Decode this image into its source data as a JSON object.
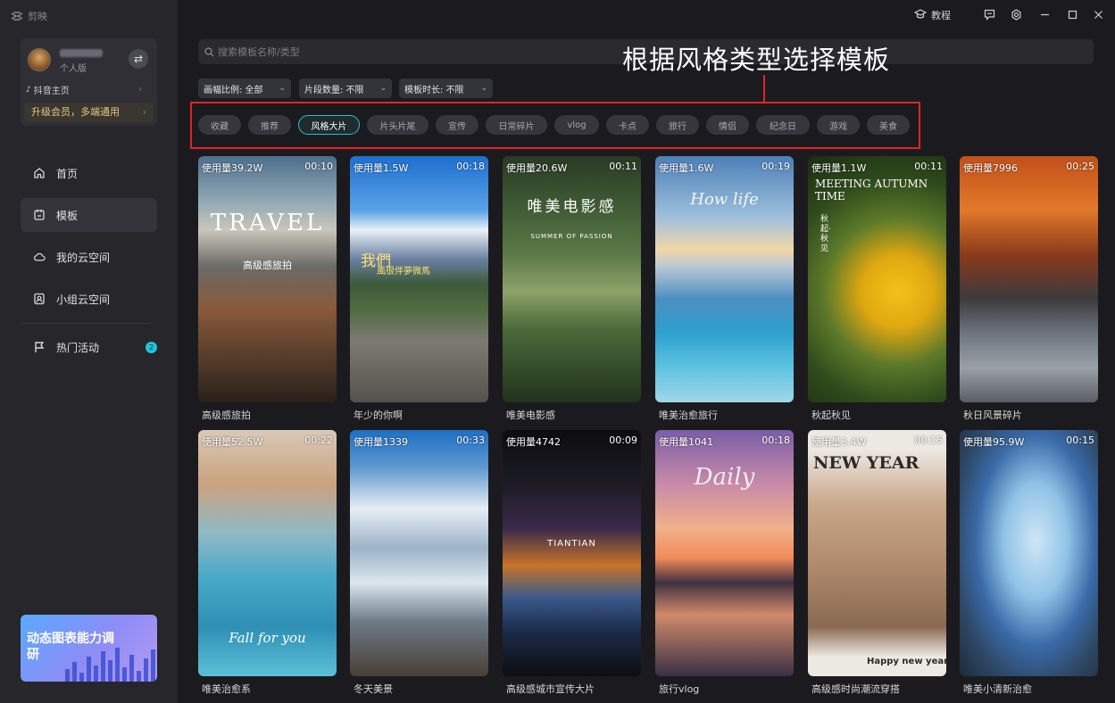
{
  "app": {
    "name": "剪映"
  },
  "profile": {
    "tier": "个人版",
    "douyin": "抖音主页",
    "upgrade": "升级会员，多端通用"
  },
  "nav": [
    {
      "label": "首页",
      "icon": "home-icon"
    },
    {
      "label": "模板",
      "icon": "template-icon"
    },
    {
      "label": "我的云空间",
      "icon": "cloud-icon"
    },
    {
      "label": "小组云空间",
      "icon": "group-cloud-icon"
    },
    {
      "label": "热门活动",
      "icon": "flag-icon",
      "badge": "2"
    }
  ],
  "banner": {
    "text": "动态图表能力调研"
  },
  "titlebar": {
    "tutorial": "教程"
  },
  "search": {
    "placeholder": "搜索模板名称/类型"
  },
  "annotation": {
    "text": "根据风格类型选择模板"
  },
  "filters": [
    {
      "label": "画幅比例: 全部"
    },
    {
      "label": "片段数量: 不限"
    },
    {
      "label": "模板时长: 不限"
    }
  ],
  "tags": [
    "收藏",
    "推荐",
    "风格大片",
    "片头片尾",
    "宣传",
    "日常碎片",
    "vlog",
    "卡点",
    "旅行",
    "情侣",
    "纪念日",
    "游戏",
    "美食"
  ],
  "active_tag": "风格大片",
  "cards": [
    {
      "usage": "使用量39.2W",
      "duration": "00:10",
      "caption": "高级感旅拍",
      "overlay_main": "TRAVEL",
      "overlay_sub": "高级感旅拍"
    },
    {
      "usage": "使用量1.5W",
      "duration": "00:18",
      "caption": "年少的你啊",
      "overlay_main": "我們",
      "overlay_sub": "風很伴夢微馬"
    },
    {
      "usage": "使用量20.6W",
      "duration": "00:11",
      "caption": "唯美电影感",
      "overlay_main": "唯美电影感",
      "overlay_sub": "SUMMER OF PASSION"
    },
    {
      "usage": "使用量1.6W",
      "duration": "00:19",
      "caption": "唯美治愈旅行",
      "overlay_main": "How life",
      "overlay_sub": ""
    },
    {
      "usage": "使用量1.1W",
      "duration": "00:11",
      "caption": "秋起秋见",
      "overlay_main": "MEETING AUTUMN TIME",
      "overlay_sub": "秋起·秋见"
    },
    {
      "usage": "使用量7996",
      "duration": "00:25",
      "caption": "秋日风景碎片",
      "overlay_main": "",
      "overlay_sub": ""
    },
    {
      "usage": "使用量52.5W",
      "duration": "00:22",
      "caption": "唯美治愈系",
      "overlay_main": "Fall for you",
      "overlay_sub": ""
    },
    {
      "usage": "使用量1339",
      "duration": "00:33",
      "caption": "冬天美景",
      "overlay_main": "",
      "overlay_sub": ""
    },
    {
      "usage": "使用量4742",
      "duration": "00:09",
      "caption": "高级感城市宣传大片",
      "overlay_main": "TIANTIAN",
      "overlay_sub": ""
    },
    {
      "usage": "使用量1041",
      "duration": "00:18",
      "caption": "旅行vlog",
      "overlay_main": "Daily",
      "overlay_sub": ""
    },
    {
      "usage": "使用量3.4W",
      "duration": "00:15",
      "caption": "高级感时尚潮流穿搭",
      "overlay_main": "NEW YEAR",
      "overlay_sub": "Happy new year"
    },
    {
      "usage": "使用量95.9W",
      "duration": "00:15",
      "caption": "唯美小清新治愈",
      "overlay_main": "",
      "overlay_sub": ""
    }
  ]
}
